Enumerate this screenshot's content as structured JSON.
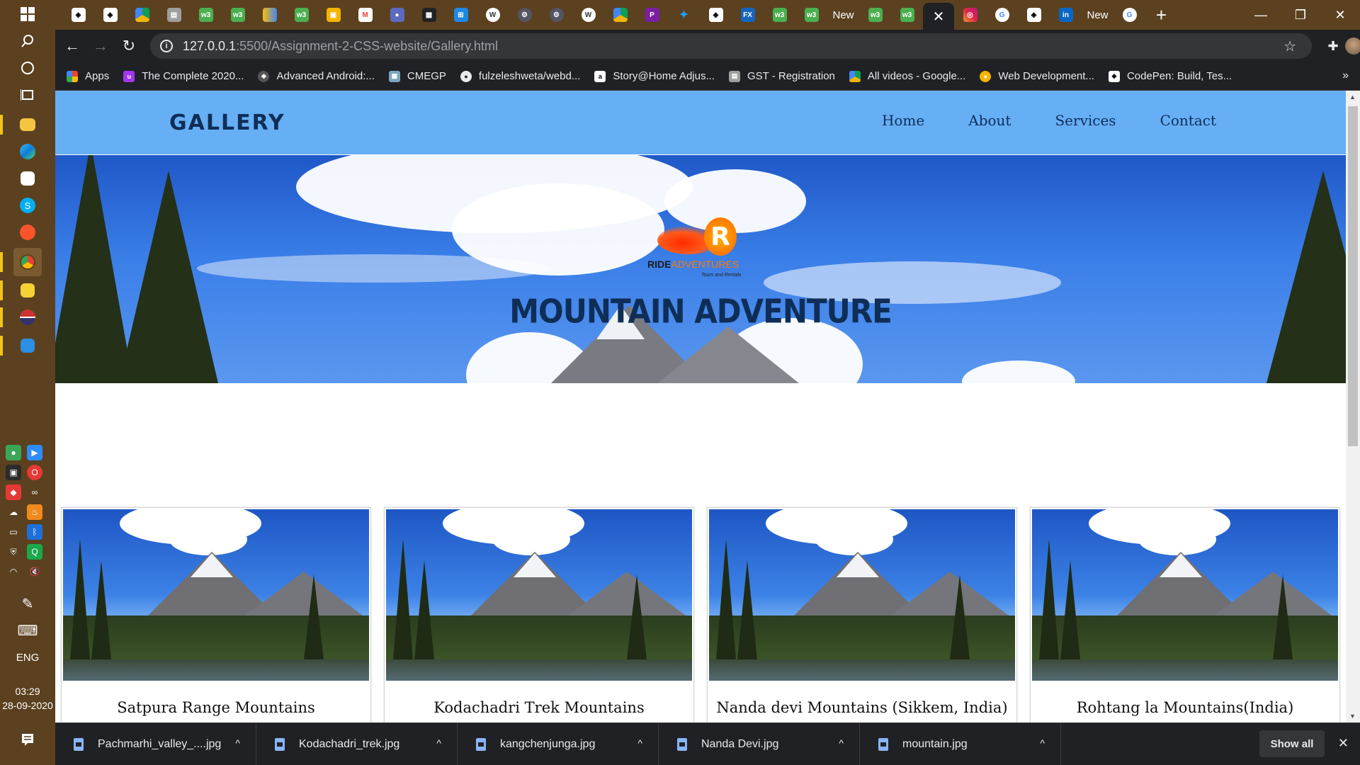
{
  "taskbar": {
    "language": "ENG",
    "time": "03:29",
    "date": "28-09-2020"
  },
  "browser": {
    "tabs_partial_labels": [
      "New",
      "New"
    ],
    "address": {
      "host": "127.0.0.1",
      "path": ":5500/Assignment-2-CSS-website/Gallery.html"
    },
    "bookmarks": [
      {
        "label": "Apps",
        "icon": "apps-grid-icon",
        "color": "#ea4335"
      },
      {
        "label": "The Complete 2020...",
        "icon": "udemy-icon",
        "color": "#a435f0"
      },
      {
        "label": "Advanced Android:...",
        "icon": "codepen-icon",
        "color": "#555555"
      },
      {
        "label": "CMEGP",
        "icon": "cmegp-icon",
        "color": "#7aa6c2"
      },
      {
        "label": "fulzeleshweta/webd...",
        "icon": "github-icon",
        "color": "#24292e"
      },
      {
        "label": "Story@Home Adjus...",
        "icon": "amazon-icon",
        "color": "#232f3e"
      },
      {
        "label": "GST - Registration",
        "icon": "gst-icon",
        "color": "#9e9e9e"
      },
      {
        "label": "All videos - Google...",
        "icon": "google-drive-icon",
        "color": "#0f9d58"
      },
      {
        "label": "Web Development...",
        "icon": "web-dev-icon",
        "color": "#f4b400"
      },
      {
        "label": "CodePen: Build, Tes...",
        "icon": "codepen-icon",
        "color": "#555555"
      }
    ]
  },
  "site": {
    "title": "GALLERY",
    "nav": [
      "Home",
      "About",
      "Services",
      "Contact"
    ],
    "logo": {
      "ride": "RIDE",
      "adventures": "ADVENTURES",
      "tagline": "Tours and Rentals"
    },
    "hero_title": "MOUNTAIN ADVENTURE",
    "gallery": [
      {
        "caption": "Satpura Range Mountains"
      },
      {
        "caption": "Kodachadri Trek Mountains"
      },
      {
        "caption": "Nanda devi Mountains (Sikkem, India)"
      },
      {
        "caption": "Rohtang la Mountains(India)"
      }
    ]
  },
  "downloads": {
    "items": [
      "Pachmarhi_valley_....jpg",
      "Kodachadri_trek.jpg",
      "kangchenjunga.jpg",
      "Nanda Devi.jpg",
      "mountain.jpg"
    ],
    "show_all": "Show all"
  },
  "colors": {
    "header_bg": "#66aff5",
    "title_color": "#0f2e57",
    "chrome_dark": "#202124",
    "taskbar": "#5b4120"
  }
}
